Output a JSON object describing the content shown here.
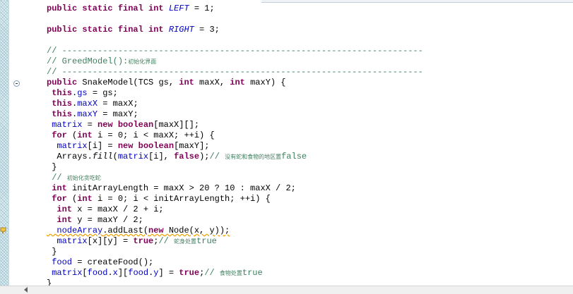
{
  "editor": {
    "icons": {
      "fold": "collapse-minus-icon",
      "warning": "warning-lightbulb-icon",
      "scroll_left": "arrow-left-icon"
    },
    "colors": {
      "keyword": "#7f0055",
      "field": "#0000c0",
      "comment": "#3f7f5f",
      "gutter": "#dfeef2",
      "warning_underline": "#f0a000"
    },
    "lines": {
      "l01": {
        "k1": "public static final int",
        "f1": "LEFT",
        "t1": " = 1;"
      },
      "l03": {
        "k1": "public static final int",
        "f1": "RIGHT",
        "t1": " = 3;"
      },
      "l05": {
        "c1": "// -----------------------------------------------------------------------"
      },
      "l06": {
        "c1": "// GreedModel():",
        "cj1": "初始化界面"
      },
      "l07": {
        "c1": "// -----------------------------------------------------------------------"
      },
      "l08": {
        "k1": "public",
        "t1": " SnakeModel(TCS gs, ",
        "k2": "int",
        "t2": " maxX, ",
        "k3": "int",
        "t3": " maxY) {"
      },
      "l09": {
        "ind": " ",
        "k1": "this",
        "t1": ".",
        "f1": "gs",
        "t2": " = gs;"
      },
      "l10": {
        "ind": " ",
        "k1": "this",
        "t1": ".",
        "f1": "maxX",
        "t2": " = maxX;"
      },
      "l11": {
        "ind": " ",
        "k1": "this",
        "t1": ".",
        "f1": "maxY",
        "t2": " = maxY;"
      },
      "l12": {
        "ind": " ",
        "f1": "matrix",
        "t1": " = ",
        "k1": "new boolean",
        "t2": "[maxX][];"
      },
      "l13": {
        "ind": " ",
        "k1": "for",
        "t1": " (",
        "k2": "int",
        "t2": " i = 0; i < maxX; ++i) {"
      },
      "l14": {
        "ind": "  ",
        "f1": "matrix",
        "t1": "[i] = ",
        "k1": "new boolean",
        "t2": "[maxY];"
      },
      "l15": {
        "ind": "  ",
        "t1": "Arrays.",
        "i1": "fill",
        "t2": "(",
        "f1": "matrix",
        "t3": "[i], ",
        "k1": "false",
        "t4": ");",
        "c1": "// ",
        "cj1": "没有蛇和食物的地区置",
        "c2": "false"
      },
      "l16": {
        "t1": " }"
      },
      "l17": {
        "ind": " ",
        "c1": "// ",
        "cj1": "初始化贪吃蛇"
      },
      "l18": {
        "ind": " ",
        "k1": "int",
        "t1": " initArrayLength = maxX > 20 ? 10 : maxX / 2;"
      },
      "l19": {
        "ind": " ",
        "k1": "for",
        "t1": " (",
        "k2": "int",
        "t2": " i = 0; i < initArrayLength; ++i) {"
      },
      "l20": {
        "ind": "  ",
        "k1": "int",
        "t1": " x = maxX / 2 + i;"
      },
      "l21": {
        "ind": "  ",
        "k1": "int",
        "t1": " y = maxY / 2;"
      },
      "l22": {
        "ind": "  ",
        "f1": "nodeArray",
        "t1": ".addLast(",
        "k1": "new",
        "t2": " Node(x, y));"
      },
      "l23": {
        "ind": "  ",
        "f1": "matrix",
        "t1": "[x][y] = ",
        "k1": "true",
        "t2": ";",
        "c1": "// ",
        "cj1": "蛇身处置",
        "c2": "true"
      },
      "l24": {
        "t1": " }"
      },
      "l25": {
        "ind": " ",
        "f1": "food",
        "t1": " = createFood();"
      },
      "l26": {
        "ind": " ",
        "f1": "matrix",
        "t1": "[",
        "f2": "food",
        "t2": ".",
        "f3": "x",
        "t3": "][",
        "f4": "food",
        "t4": ".",
        "f5": "y",
        "t5": "] = ",
        "k1": "true",
        "t6": ";",
        "c1": "// ",
        "cj1": "食物处置",
        "c2": "true"
      },
      "l27": {
        "t1": "}"
      }
    }
  }
}
